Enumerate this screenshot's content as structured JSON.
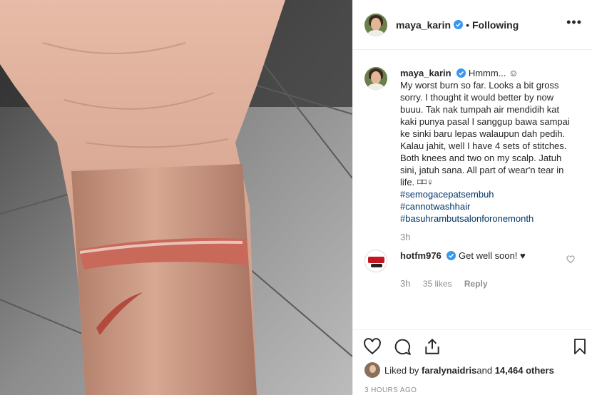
{
  "post": {
    "username": "maya_karin",
    "separator": "•",
    "follow_label": "Following",
    "more_label": "•••"
  },
  "caption": {
    "username": "maya_karin",
    "lines": [
      "Hmmm... ☺",
      "My worst burn so far. Looks a bit gross sorry. I thought it would better by now buuu. Tak nak tumpah air mendidih kat kaki punya pasal I sanggup bawa sampai ke sinki baru lepas walaupun dah pedih.",
      "Kalau jahit, well I have 4 sets of stitches. Both knees and two on my scalp. Jatuh sini, jatuh sana. All part of wear'n tear in life. ⌑⌑♀"
    ],
    "hashtags": [
      "#semogacepatsembuh",
      "#cannotwashhair",
      "#basuhrambutsalonforonemonth"
    ],
    "time": "3h"
  },
  "comment": {
    "username": "hotfm976",
    "text": "Get well soon! ♥",
    "time": "3h",
    "likes": "35 likes",
    "reply_label": "Reply"
  },
  "likes": {
    "prefix": "Liked by ",
    "user": "faralynaidris",
    "middle": " and ",
    "count": "14,464 others"
  },
  "timestamp": "3 HOURS AGO",
  "icons": [
    "verified-badge-icon",
    "heart-icon",
    "comment-icon",
    "share-icon",
    "bookmark-icon",
    "more-options-icon"
  ],
  "colors": {
    "verified": "#3897f0",
    "hashtag": "#003569",
    "muted": "#8e8e8e",
    "text": "#262626"
  }
}
